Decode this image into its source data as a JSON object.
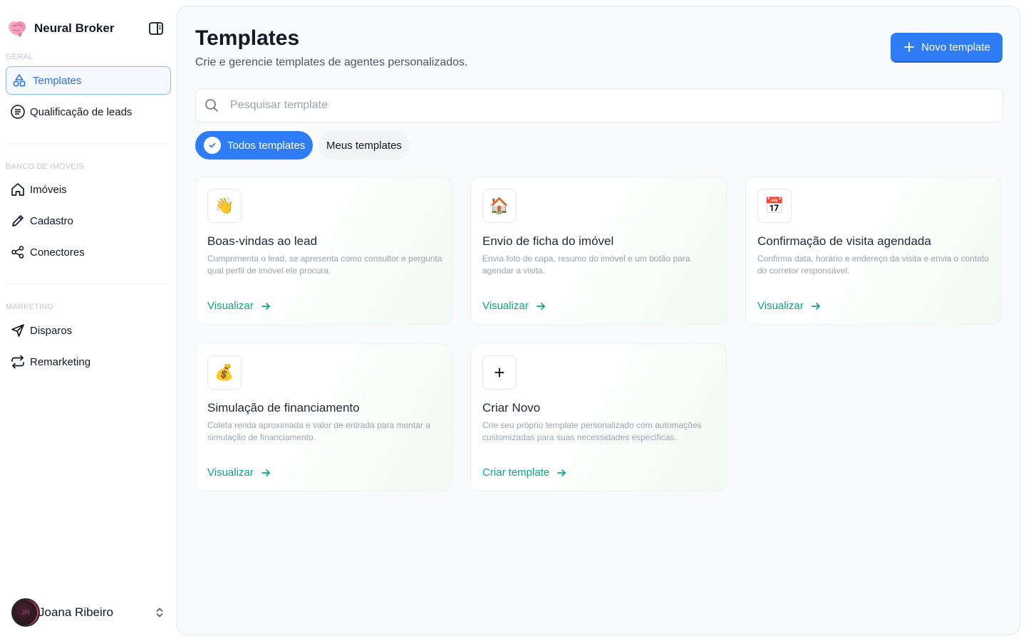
{
  "app": {
    "name": "Neural Broker"
  },
  "sidebar": {
    "sections": [
      {
        "label": "GERAL",
        "items": [
          {
            "label": "Templates",
            "icon": "shapes-icon",
            "active": true
          },
          {
            "label": "Qualificação de leads",
            "icon": "list-circle-icon"
          }
        ]
      },
      {
        "label": "BANCO DE IMÓVEIS",
        "items": [
          {
            "label": "Imóveis",
            "icon": "home-icon"
          },
          {
            "label": "Cadastro",
            "icon": "pencil-icon"
          },
          {
            "label": "Conectores",
            "icon": "share-icon"
          }
        ]
      },
      {
        "label": "MARKETING",
        "items": [
          {
            "label": "Disparos",
            "icon": "send-icon"
          },
          {
            "label": "Remarketing",
            "icon": "repeat-icon"
          }
        ]
      }
    ],
    "user": {
      "name": "Joana Ribeiro",
      "initials": "JR"
    }
  },
  "main": {
    "title": "Templates",
    "subtitle": "Crie e gerencie templates de agentes personalizados.",
    "new_button": "Novo template",
    "search_placeholder": "Pesquisar template",
    "filters": [
      {
        "label": "Todos templates",
        "active": true
      },
      {
        "label": "Meus templates",
        "active": false
      }
    ],
    "cards": [
      {
        "icon": "👋",
        "title": "Boas-vindas ao lead",
        "description": "Cumprimenta o lead, se apresenta como consultor e pergunta qual perfil de imóvel ele procura.",
        "link": "Visualizar"
      },
      {
        "icon": "🏠",
        "title": "Envio de ficha do imóvel",
        "description": "Envia foto de capa, resumo do imóvel e um botão para agendar a visita.",
        "link": "Visualizar"
      },
      {
        "icon": "📅",
        "title": "Confirmação de visita agendada",
        "description": "Confirma data, horário e endereço da visita e envia o contato do corretor responsável.",
        "link": "Visualizar"
      },
      {
        "icon": "💰",
        "title": "Simulação de financiamento",
        "description": "Coleta renda aproximada e valor de entrada para montar a simulação de financiamento.",
        "link": "Visualizar"
      },
      {
        "icon": "+",
        "title": "Criar Novo",
        "description": "Crie seu próprio template personalizado com automações customizadas para suas necessidades específicas.",
        "link": "Criar template"
      }
    ]
  },
  "colors": {
    "accent": "#2f7df6",
    "link": "#10a37f",
    "background": "#f9fafb"
  }
}
